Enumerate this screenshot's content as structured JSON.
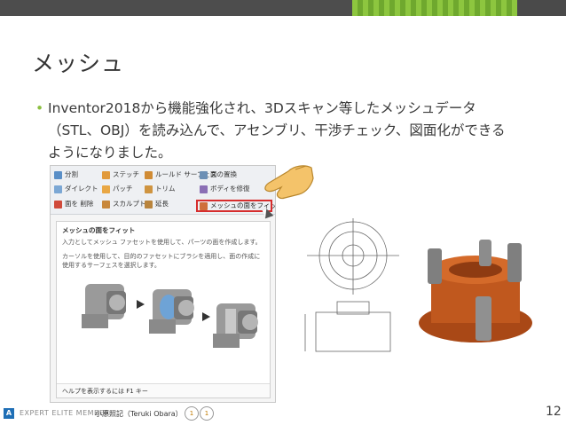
{
  "slide": {
    "title": "メッシュ",
    "bullet_line1": "Inventor2018から機能強化され、3Dスキャン等したメッシュデータ",
    "bullet_line2": "（STL、OBJ）を読み込んで、アセンブリ、干渉チェック、図面化ができる",
    "bullet_line3": "ようになりました。",
    "page_number": "12"
  },
  "ribbon": {
    "items": [
      {
        "label": "分割",
        "icon": "split-icon"
      },
      {
        "label": "ダイレクト",
        "icon": "direct-edit-icon"
      },
      {
        "label": "面を 削除",
        "icon": "delete-face-icon"
      },
      {
        "label": "ステッチ",
        "icon": "stitch-icon"
      },
      {
        "label": "パッチ",
        "icon": "patch-icon"
      },
      {
        "label": "スカルプト",
        "icon": "sculpt-icon"
      },
      {
        "label": "ルールド サーフェス",
        "icon": "ruled-surface-icon"
      },
      {
        "label": "トリム",
        "icon": "trim-icon"
      },
      {
        "label": "延長",
        "icon": "extend-icon"
      },
      {
        "label": "面の置換",
        "icon": "replace-face-icon"
      },
      {
        "label": "ボディを修復",
        "icon": "repair-bodies-icon"
      },
      {
        "label": "メッシュの面をフィット",
        "icon": "fit-mesh-face-icon"
      }
    ]
  },
  "tooltip": {
    "title": "メッシュの面をフィット",
    "desc1": "入力としてメッシュ ファセットを使用して、パーツの面を作成します。",
    "desc2": "カーソルを使用して、目的のファセットにブラシを適用し、面の作成に使用するサーフェスを選択します。",
    "help": "ヘルプを表示するには F1 キー"
  },
  "footer": {
    "badge": "A",
    "program": "EXPERT ELITE MEMBER",
    "author": "小原照記（Teruki Obara）",
    "medal1": "1",
    "medal2": "1"
  },
  "colors": {
    "accent_green": "#8dc63f",
    "highlight_red": "#d62d2d",
    "part_orange": "#c0581e"
  }
}
